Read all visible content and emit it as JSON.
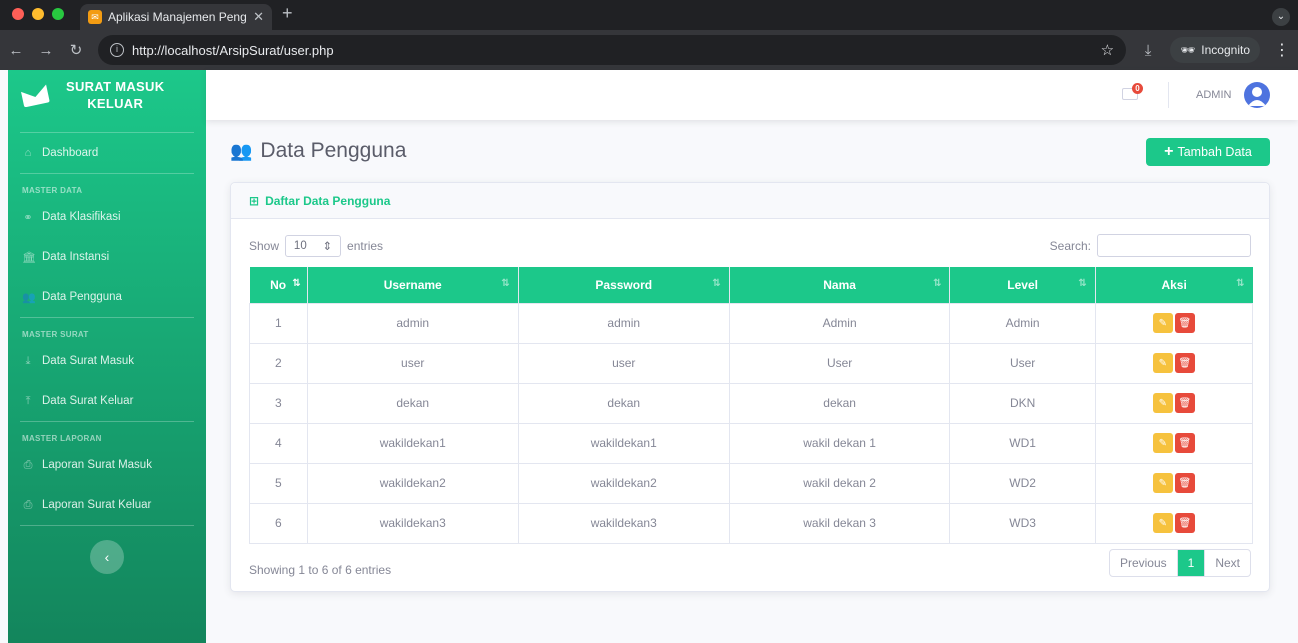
{
  "browser": {
    "tab_title": "Aplikasi Manajemen Pengelol",
    "url": "http://localhost/ArsipSurat/user.php",
    "incognito_label": "Incognito"
  },
  "sidebar": {
    "brand": "SURAT MASUK\nKELUAR",
    "brand_line1": "SURAT MASUK",
    "brand_line2": "KELUAR",
    "dashboard": "Dashboard",
    "sections": {
      "master_data": "MASTER DATA",
      "master_surat": "MASTER SURAT",
      "master_laporan": "MASTER LAPORAN"
    },
    "items": {
      "klasifikasi": "Data Klasifikasi",
      "instansi": "Data Instansi",
      "pengguna": "Data Pengguna",
      "surat_masuk": "Data Surat Masuk",
      "surat_keluar": "Data Surat Keluar",
      "lap_masuk": "Laporan Surat Masuk",
      "lap_keluar": "Laporan Surat Keluar"
    }
  },
  "topbar": {
    "mail_badge": "0",
    "user_label": "ADMIN"
  },
  "page": {
    "title": "Data Pengguna",
    "add_button": "Tambah Data"
  },
  "card": {
    "title": "Daftar Data Pengguna",
    "show_label": "Show",
    "show_value": "10",
    "entries_label": "entries",
    "search_label": "Search:",
    "info": "Showing 1 to 6 of 6 entries",
    "pager": {
      "prev": "Previous",
      "current": "1",
      "next": "Next"
    }
  },
  "table": {
    "headers": [
      "No",
      "Username",
      "Password",
      "Nama",
      "Level",
      "Aksi"
    ],
    "rows": [
      [
        "1",
        "admin",
        "admin",
        "Admin",
        "Admin"
      ],
      [
        "2",
        "user",
        "user",
        "User",
        "User"
      ],
      [
        "3",
        "dekan",
        "dekan",
        "dekan",
        "DKN"
      ],
      [
        "4",
        "wakildekan1",
        "wakildekan1",
        "wakil dekan 1",
        "WD1"
      ],
      [
        "5",
        "wakildekan2",
        "wakildekan2",
        "wakil dekan 2",
        "WD2"
      ],
      [
        "6",
        "wakildekan3",
        "wakildekan3",
        "wakil dekan 3",
        "WD3"
      ]
    ]
  }
}
